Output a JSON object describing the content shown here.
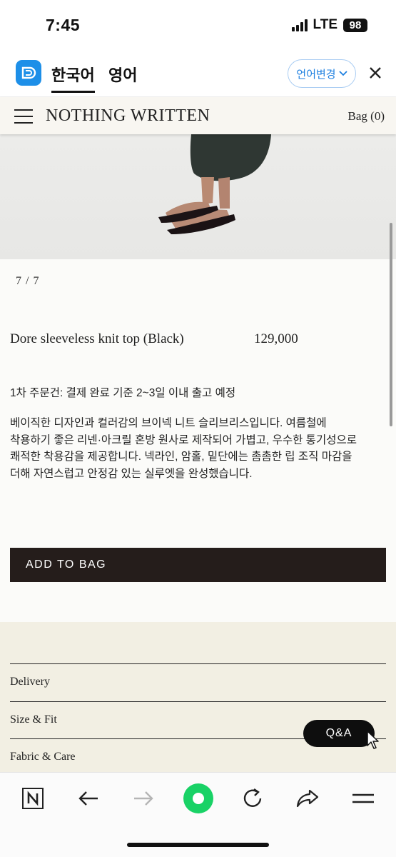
{
  "status_bar": {
    "time": "7:45",
    "network": "LTE",
    "battery": "98"
  },
  "translate_bar": {
    "tab_korean": "한국어",
    "tab_english": "영어",
    "language_change": "언어변경"
  },
  "site_header": {
    "brand": "NOTHING WRITTEN",
    "bag": "Bag (0)"
  },
  "product": {
    "image_counter": "7 / 7",
    "name": "Dore sleeveless knit top (Black)",
    "price": "129,000",
    "shipping_note": "1차 주문건: 결제 완료 기준 2~3일 이내 출고 예정",
    "description_lines": [
      "베이직한 디자인과 컬러감의 브이넥 니트 슬리브리스입니다. 여름철에",
      "착용하기 좋은 리넨·아크릴 혼방 원사로 제작되어 가볍고, 우수한 통기성으로",
      "쾌적한 착용감을 제공합니다. 넥라인, 암홀, 밑단에는 촘촘한 립 조직 마감을",
      "더해 자연스럽고 안정감 있는 실루엣을 완성했습니다."
    ],
    "add_to_bag": "ADD TO BAG"
  },
  "accordion": {
    "items": [
      "Delivery",
      "Size & Fit",
      "Fabric & Care"
    ]
  },
  "qa_button": "Q&A",
  "colors": {
    "accent_blue": "#1d8fe8",
    "button_dark": "#251d1b",
    "accordion_bg": "#f2efe3",
    "header_bg": "#f8f6f1",
    "record_green": "#19d266"
  },
  "toolbar_icons": [
    "n-logo-icon",
    "back-arrow-icon",
    "forward-arrow-icon",
    "record-icon",
    "reload-icon",
    "share-icon",
    "menu-icon"
  ]
}
